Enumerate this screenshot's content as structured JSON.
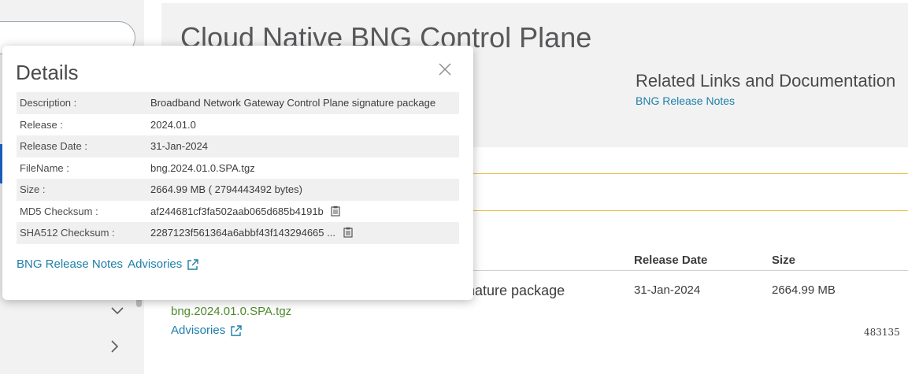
{
  "header": {
    "title": "Cloud Native BNG Control Plane",
    "related_heading": "Related Links and Documentation",
    "related_link": "BNG Release Notes"
  },
  "table": {
    "columns": {
      "release_date": "Release Date",
      "size": "Size"
    },
    "row": {
      "description_fragment": "gnature package",
      "release_date": "31-Jan-2024",
      "size": "2664.99 MB",
      "filename": "bng.2024.01.0.SPA.tgz",
      "advisories": "Advisories",
      "id": "483135"
    }
  },
  "details": {
    "title": "Details",
    "fields": [
      {
        "key": "Description :",
        "value": "Broadband Network Gateway Control Plane signature package"
      },
      {
        "key": "Release :",
        "value": "2024.01.0"
      },
      {
        "key": "Release Date :",
        "value": "31-Jan-2024"
      },
      {
        "key": "FileName :",
        "value": "bng.2024.01.0.SPA.tgz"
      },
      {
        "key": "Size :",
        "value": "2664.99 MB ( 2794443492 bytes)"
      },
      {
        "key": "MD5 Checksum :",
        "value": "af244681cf3fa502aab065d685b4191b"
      },
      {
        "key": "SHA512 Checksum :",
        "value": "2287123f561364a6abbf43f143294665 ..."
      }
    ],
    "links": {
      "release_notes": "BNG Release Notes",
      "advisories": "Advisories"
    }
  },
  "icons": {
    "close": "close-icon",
    "copy": "clipboard-icon",
    "external": "external-link-icon",
    "chevron_down": "chevron-down-icon",
    "chevron_right": "chevron-right-icon"
  },
  "colors": {
    "link": "#1d7fa8",
    "filename": "#4e8a2c",
    "banner_border": "#e6c34a",
    "header_bg": "#f2f2f2"
  }
}
